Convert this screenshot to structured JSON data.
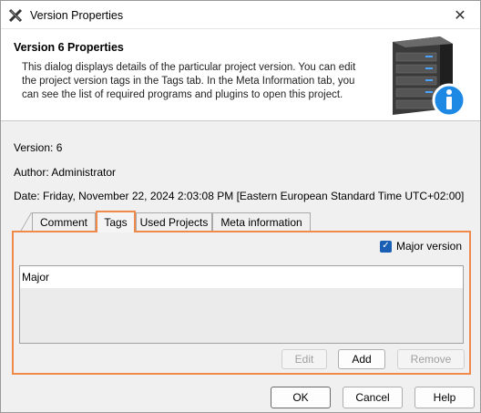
{
  "window": {
    "title": "Version Properties"
  },
  "header": {
    "title": "Version 6 Properties",
    "description": "This dialog displays details of the particular project version. You can edit the project version tags in the Tags tab. In the Meta Information tab, you can see the list of required programs and plugins to open this project."
  },
  "info": {
    "version": "Version: 6",
    "author": "Author: Administrator",
    "date": "Date: Friday, November 22, 2024 2:03:08 PM [Eastern European Standard Time UTC+02:00]"
  },
  "tabs": [
    {
      "label": "Comment",
      "selected": false
    },
    {
      "label": "Tags",
      "selected": true
    },
    {
      "label": "Used Projects",
      "selected": false
    },
    {
      "label": "Meta information",
      "selected": false
    }
  ],
  "tags_panel": {
    "major_version_label": "Major version",
    "major_version_checked": true,
    "tag_list": [
      "Major"
    ],
    "edit_label": "Edit",
    "add_label": "Add",
    "remove_label": "Remove"
  },
  "footer": {
    "ok_label": "OK",
    "cancel_label": "Cancel",
    "help_label": "Help"
  },
  "colors": {
    "highlight": "#f08a4b",
    "checkbox": "#1a5fb4",
    "info_badge": "#1e88e5"
  }
}
